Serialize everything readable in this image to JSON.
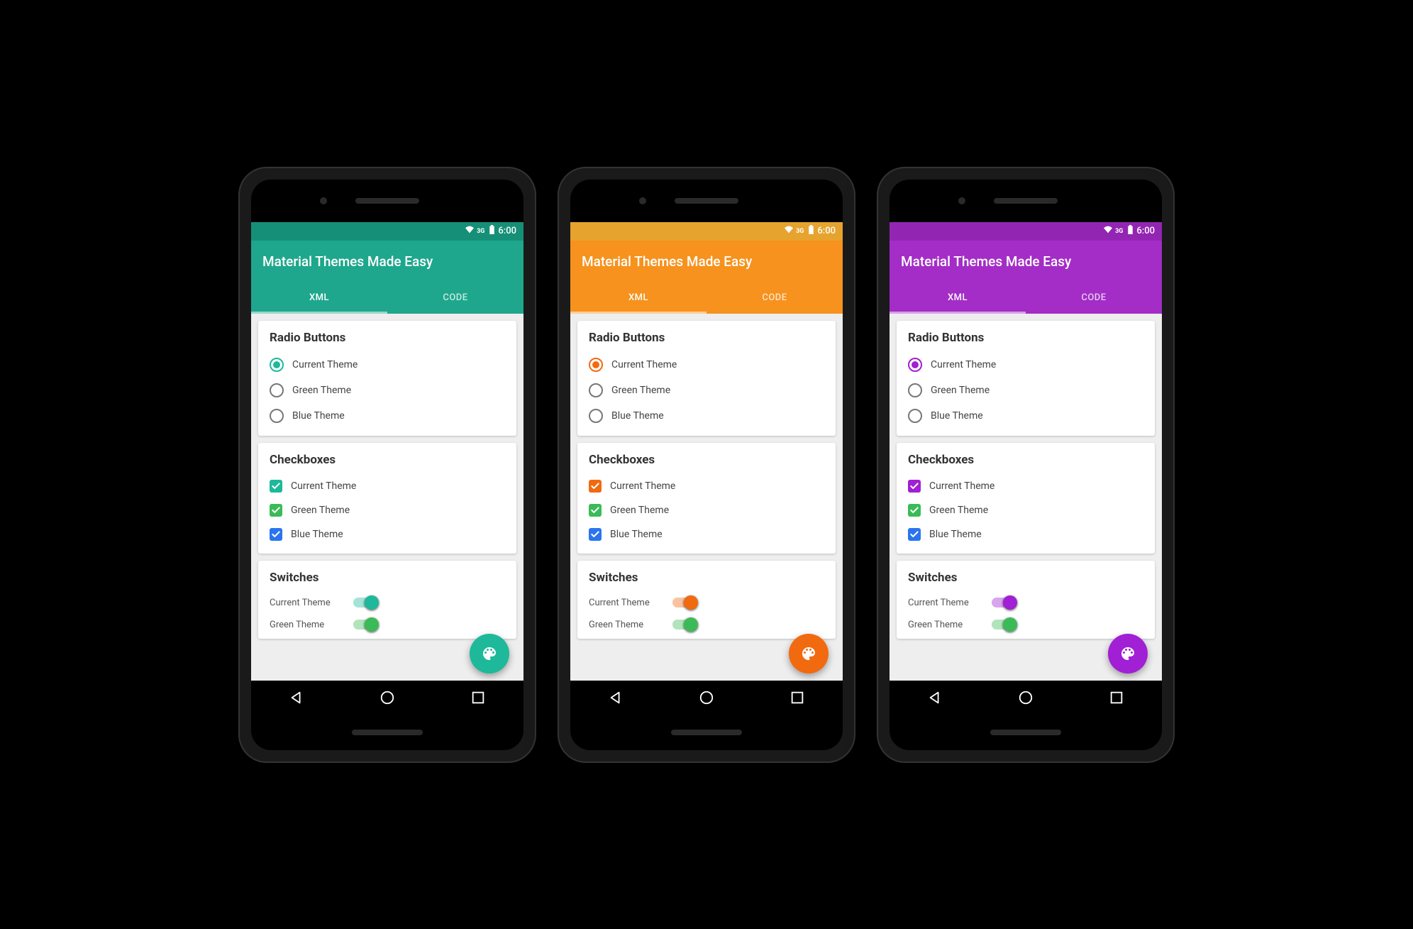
{
  "status": {
    "time": "6:00",
    "network": "3G"
  },
  "app": {
    "title": "Material Themes Made Easy",
    "tabs": [
      "XML",
      "CODE"
    ],
    "active_tab": 0
  },
  "sections": {
    "radio": {
      "title": "Radio Buttons",
      "items": [
        {
          "label": "Current Theme",
          "checked": true,
          "color": "accent"
        },
        {
          "label": "Green Theme",
          "checked": false,
          "color": "#777"
        },
        {
          "label": "Blue Theme",
          "checked": false,
          "color": "#777"
        }
      ]
    },
    "checkbox": {
      "title": "Checkboxes",
      "items": [
        {
          "label": "Current Theme",
          "color": "accent"
        },
        {
          "label": "Green Theme",
          "color": "#3bbb57"
        },
        {
          "label": "Blue Theme",
          "color": "#2b74f0"
        }
      ]
    },
    "switch": {
      "title": "Switches",
      "items": [
        {
          "label": "Current Theme",
          "color": "accent"
        },
        {
          "label": "Green Theme",
          "color": "#3bbb57"
        }
      ]
    }
  },
  "fab": {
    "icon": "palette"
  },
  "phones": [
    {
      "name": "teal",
      "primary": "#1ea78c",
      "primary_dark": "#168f78",
      "accent": "#1db99a"
    },
    {
      "name": "orange",
      "primary": "#f6921d",
      "primary_dark": "#e6a32e",
      "accent": "#f26a10"
    },
    {
      "name": "purple",
      "primary": "#a32dc6",
      "primary_dark": "#9325b3",
      "accent": "#a11fd4"
    }
  ]
}
